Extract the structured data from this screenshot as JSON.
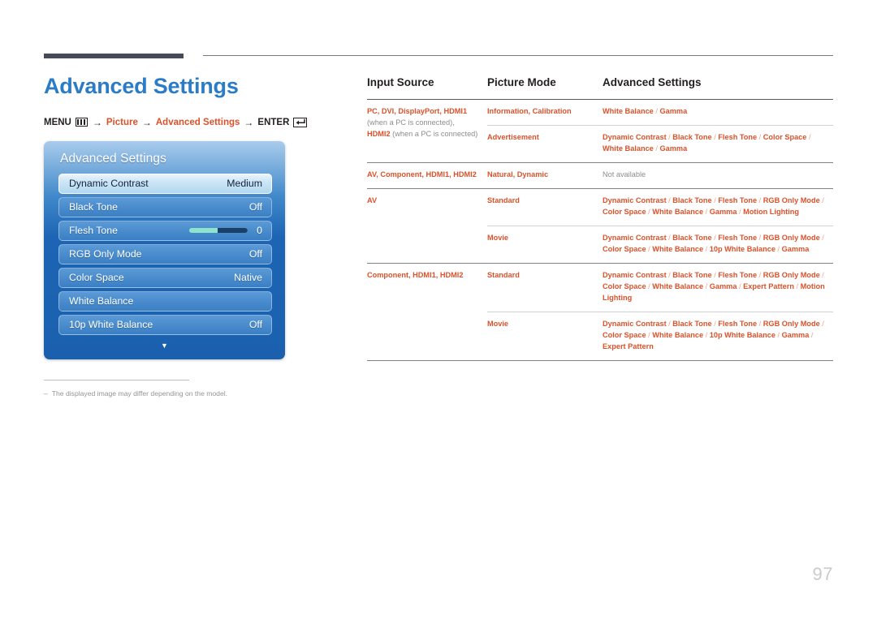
{
  "page": {
    "title": "Advanced Settings",
    "number": "97"
  },
  "breadcrumb": {
    "menu_label": "MENU",
    "menu_icon": "menu-bars-icon",
    "arrow": "→",
    "picture_label": "Picture",
    "advanced_label": "Advanced Settings",
    "enter_label": "ENTER",
    "enter_icon": "enter-return-icon"
  },
  "osd": {
    "header": "Advanced Settings",
    "scroll_down_icon": "▼",
    "rows": [
      {
        "label": "Dynamic Contrast",
        "value": "Medium",
        "selected": true,
        "type": "value"
      },
      {
        "label": "Black Tone",
        "value": "Off",
        "selected": false,
        "type": "value"
      },
      {
        "label": "Flesh Tone",
        "value": "0",
        "selected": false,
        "type": "slider"
      },
      {
        "label": "RGB Only Mode",
        "value": "Off",
        "selected": false,
        "type": "value"
      },
      {
        "label": "Color Space",
        "value": "Native",
        "selected": false,
        "type": "value"
      },
      {
        "label": "White Balance",
        "value": "",
        "selected": false,
        "type": "value"
      },
      {
        "label": "10p White Balance",
        "value": "Off",
        "selected": false,
        "type": "value"
      }
    ]
  },
  "note": {
    "dash": "–",
    "text": "The displayed image may differ depending on the model."
  },
  "table": {
    "headers": [
      "Input Source",
      "Picture Mode",
      "Advanced Settings"
    ],
    "rows": [
      {
        "input_parts": [
          {
            "text": "PC",
            "muted": false
          },
          {
            "text": ", ",
            "muted": false
          },
          {
            "text": "DVI",
            "muted": false
          },
          {
            "text": ", ",
            "muted": false
          },
          {
            "text": "DisplayPort",
            "muted": false
          },
          {
            "text": ", ",
            "muted": false
          },
          {
            "text": "HDMI1",
            "muted": false
          },
          {
            "text": " ",
            "muted": true
          },
          {
            "text": "(when a PC is connected),",
            "muted": true
          },
          {
            "text": " ",
            "muted": true
          },
          {
            "text": "HDMI2",
            "muted": false
          },
          {
            "text": " ",
            "muted": true
          },
          {
            "text": "(when a PC is connected)",
            "muted": true
          }
        ],
        "input_rowspan": 2,
        "modes": [
          {
            "mode_parts": [
              {
                "text": "Information",
                "muted": false
              },
              {
                "text": ", ",
                "muted": false
              },
              {
                "text": "Calibration",
                "muted": false
              }
            ],
            "settings_parts": [
              {
                "text": "White Balance",
                "muted": false
              },
              {
                "text": " / ",
                "sep": true
              },
              {
                "text": "Gamma",
                "muted": false
              }
            ],
            "sep": "sub"
          },
          {
            "mode_parts": [
              {
                "text": "Advertisement",
                "muted": false
              }
            ],
            "settings_parts": [
              {
                "text": "Dynamic Contrast",
                "muted": false
              },
              {
                "text": " / ",
                "sep": true
              },
              {
                "text": "Black Tone",
                "muted": false
              },
              {
                "text": " / ",
                "sep": true
              },
              {
                "text": "Flesh Tone",
                "muted": false
              },
              {
                "text": " / ",
                "sep": true
              },
              {
                "text": "Color Space",
                "muted": false
              },
              {
                "text": " / ",
                "sep": true
              },
              {
                "text": "White Balance",
                "muted": false
              },
              {
                "text": " / ",
                "sep": true
              },
              {
                "text": "Gamma",
                "muted": false
              }
            ],
            "sep": "group"
          }
        ]
      },
      {
        "input_parts": [
          {
            "text": "AV",
            "muted": false
          },
          {
            "text": ", ",
            "muted": false
          },
          {
            "text": "Component",
            "muted": false
          },
          {
            "text": ", ",
            "muted": false
          },
          {
            "text": "HDMI1",
            "muted": false
          },
          {
            "text": ", ",
            "muted": false
          },
          {
            "text": "HDMI2",
            "muted": false
          }
        ],
        "input_rowspan": 1,
        "modes": [
          {
            "mode_parts": [
              {
                "text": "Natural",
                "muted": false
              },
              {
                "text": ", ",
                "muted": false
              },
              {
                "text": "Dynamic",
                "muted": false
              }
            ],
            "settings_parts": [
              {
                "text": "Not available",
                "muted": true
              }
            ],
            "sep": "group"
          }
        ]
      },
      {
        "input_parts": [
          {
            "text": "AV",
            "muted": false
          }
        ],
        "input_rowspan": 2,
        "modes": [
          {
            "mode_parts": [
              {
                "text": "Standard",
                "muted": false
              }
            ],
            "settings_parts": [
              {
                "text": "Dynamic Contrast",
                "muted": false
              },
              {
                "text": " / ",
                "sep": true
              },
              {
                "text": "Black Tone",
                "muted": false
              },
              {
                "text": " / ",
                "sep": true
              },
              {
                "text": "Flesh Tone",
                "muted": false
              },
              {
                "text": " / ",
                "sep": true
              },
              {
                "text": "RGB Only Mode",
                "muted": false
              },
              {
                "text": " / ",
                "sep": true
              },
              {
                "text": "Color Space",
                "muted": false
              },
              {
                "text": " / ",
                "sep": true
              },
              {
                "text": "White Balance",
                "muted": false
              },
              {
                "text": " / ",
                "sep": true
              },
              {
                "text": "Gamma",
                "muted": false
              },
              {
                "text": " / ",
                "sep": true
              },
              {
                "text": "Motion Lighting",
                "muted": false
              }
            ],
            "sep": "sub"
          },
          {
            "mode_parts": [
              {
                "text": "Movie",
                "muted": false
              }
            ],
            "settings_parts": [
              {
                "text": "Dynamic Contrast",
                "muted": false
              },
              {
                "text": " / ",
                "sep": true
              },
              {
                "text": "Black Tone",
                "muted": false
              },
              {
                "text": " / ",
                "sep": true
              },
              {
                "text": "Flesh Tone",
                "muted": false
              },
              {
                "text": " / ",
                "sep": true
              },
              {
                "text": "RGB Only Mode",
                "muted": false
              },
              {
                "text": " / ",
                "sep": true
              },
              {
                "text": "Color Space",
                "muted": false
              },
              {
                "text": " / ",
                "sep": true
              },
              {
                "text": "White Balance",
                "muted": false
              },
              {
                "text": " / ",
                "sep": true
              },
              {
                "text": "10p White Balance",
                "muted": false
              },
              {
                "text": " / ",
                "sep": true
              },
              {
                "text": "Gamma",
                "muted": false
              }
            ],
            "sep": "group"
          }
        ]
      },
      {
        "input_parts": [
          {
            "text": "Component",
            "muted": false
          },
          {
            "text": ", ",
            "muted": false
          },
          {
            "text": "HDMI1",
            "muted": false
          },
          {
            "text": ", ",
            "muted": false
          },
          {
            "text": "HDMI2",
            "muted": false
          }
        ],
        "input_rowspan": 2,
        "modes": [
          {
            "mode_parts": [
              {
                "text": "Standard",
                "muted": false
              }
            ],
            "settings_parts": [
              {
                "text": "Dynamic Contrast",
                "muted": false
              },
              {
                "text": " / ",
                "sep": true
              },
              {
                "text": "Black Tone",
                "muted": false
              },
              {
                "text": " / ",
                "sep": true
              },
              {
                "text": "Flesh Tone",
                "muted": false
              },
              {
                "text": " / ",
                "sep": true
              },
              {
                "text": "RGB Only Mode",
                "muted": false
              },
              {
                "text": " / ",
                "sep": true
              },
              {
                "text": "Color Space",
                "muted": false
              },
              {
                "text": " / ",
                "sep": true
              },
              {
                "text": "White Balance",
                "muted": false
              },
              {
                "text": " / ",
                "sep": true
              },
              {
                "text": "Gamma",
                "muted": false
              },
              {
                "text": " / ",
                "sep": true
              },
              {
                "text": "Expert Pattern",
                "muted": false
              },
              {
                "text": " / ",
                "sep": true
              },
              {
                "text": "Motion Lighting",
                "muted": false
              }
            ],
            "sep": "sub"
          },
          {
            "mode_parts": [
              {
                "text": "Movie",
                "muted": false
              }
            ],
            "settings_parts": [
              {
                "text": "Dynamic Contrast",
                "muted": false
              },
              {
                "text": " / ",
                "sep": true
              },
              {
                "text": "Black Tone",
                "muted": false
              },
              {
                "text": " / ",
                "sep": true
              },
              {
                "text": "Flesh Tone",
                "muted": false
              },
              {
                "text": " / ",
                "sep": true
              },
              {
                "text": "RGB Only Mode",
                "muted": false
              },
              {
                "text": " / ",
                "sep": true
              },
              {
                "text": "Color Space",
                "muted": false
              },
              {
                "text": " / ",
                "sep": true
              },
              {
                "text": "White Balance",
                "muted": false
              },
              {
                "text": " / ",
                "sep": true
              },
              {
                "text": "10p White Balance",
                "muted": false
              },
              {
                "text": " / ",
                "sep": true
              },
              {
                "text": "Gamma",
                "muted": false
              },
              {
                "text": " / ",
                "sep": true
              },
              {
                "text": "Expert Pattern",
                "muted": false
              }
            ],
            "sep": "group"
          }
        ]
      }
    ]
  },
  "colors": {
    "title_blue": "#2a7cc7",
    "accent_orange": "#d9522b",
    "muted_gray": "#8b8d8f",
    "rule_dark": "#474a57"
  }
}
